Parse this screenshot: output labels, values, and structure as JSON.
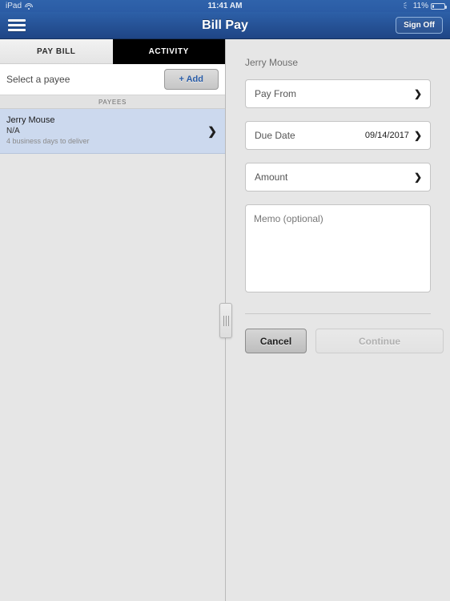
{
  "status_bar": {
    "device": "iPad",
    "wifi_icon": "wifi-icon",
    "time": "11:41 AM",
    "bluetooth_icon": "bluetooth-icon",
    "battery_percent": "11%",
    "battery_level": 11
  },
  "nav_bar": {
    "menu_icon": "hamburger-menu-icon",
    "title": "Bill Pay",
    "sign_off_label": "Sign Off"
  },
  "left_pane": {
    "tabs": [
      {
        "label": "PAY BILL",
        "selected": true
      },
      {
        "label": "ACTIVITY",
        "selected": false
      }
    ],
    "select_payee_label": "Select a payee",
    "add_button_label": "+ Add",
    "payees_section_header": "PAYEES",
    "payees": [
      {
        "name": "Jerry Mouse",
        "account": "N/A",
        "delivery": "4 business days to deliver",
        "chevron": "chevron-right-icon",
        "selected": true
      }
    ]
  },
  "split_handle": {
    "name": "split-view-drag-handle"
  },
  "right_pane": {
    "title": "Jerry Mouse",
    "fields": [
      {
        "label": "Pay From",
        "value": "",
        "chevron": "chevron-right-icon"
      },
      {
        "label": "Due Date",
        "value": "09/14/2017",
        "chevron": "chevron-right-icon"
      },
      {
        "label": "Amount",
        "value": "",
        "chevron": "chevron-right-icon"
      }
    ],
    "memo_placeholder": "Memo (optional)",
    "memo_value": "",
    "cancel_label": "Cancel",
    "continue_label": "Continue",
    "continue_enabled": false
  },
  "colors": {
    "nav_top": "#2d60a8",
    "nav_bottom": "#1f4585",
    "pane_background": "#e6e6e6",
    "selected_row": "#ccd9ee",
    "accent_blue": "#2a5da8",
    "tab_unselected_bg": "#000000"
  }
}
